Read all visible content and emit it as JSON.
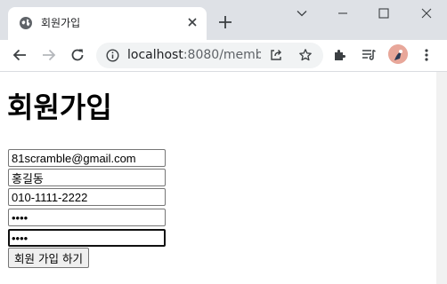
{
  "browser": {
    "tab_title": "회원가입",
    "url_host": "localhost",
    "url_rest": ":8080/memb..."
  },
  "page": {
    "heading": "회원가입",
    "fields": [
      {
        "name": "email",
        "value": "81scramble@gmail.com",
        "type": "text"
      },
      {
        "name": "name",
        "value": "홍길동",
        "type": "text"
      },
      {
        "name": "phone",
        "value": "010-1111-2222",
        "type": "text"
      },
      {
        "name": "password",
        "value": "1234",
        "type": "password"
      },
      {
        "name": "password-confirm",
        "value": "1234",
        "type": "password"
      }
    ],
    "submit_label": "회원 가입 하기"
  },
  "colors": {
    "titlebar": "#dee1e6",
    "omnibox": "#f1f3f4",
    "avatar": "#e8a79a"
  }
}
